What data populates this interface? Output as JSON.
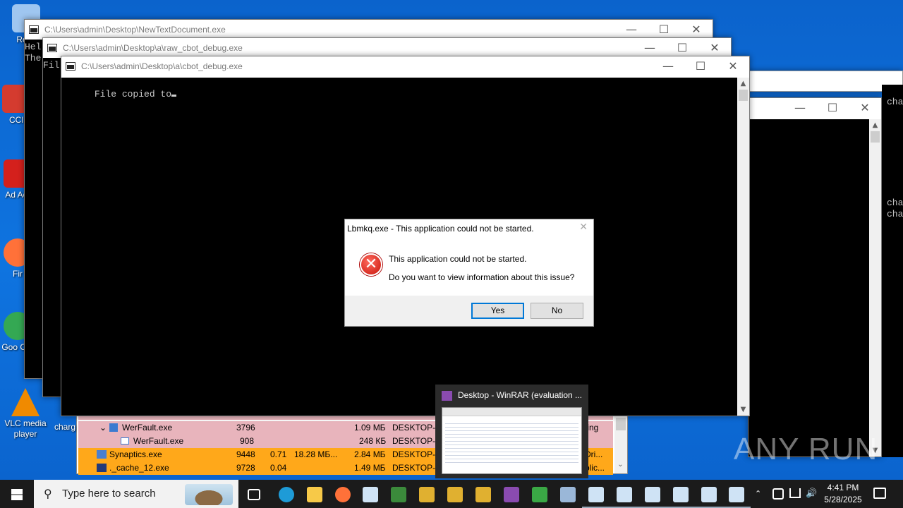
{
  "desktop_icons": [
    {
      "label": "Recy",
      "icon": "recycle-bin-icon",
      "color": "#9fc6f0"
    },
    {
      "label": "CCl",
      "icon": "ccleaner-icon",
      "color": "#d43b2f"
    },
    {
      "label": "Ad Acr",
      "icon": "acrobat-icon",
      "color": "#d4201c"
    },
    {
      "label": "Fir",
      "icon": "firefox-icon",
      "color": "#ff7139"
    },
    {
      "label": "Goo Chr",
      "icon": "chrome-icon",
      "color": "#34a853"
    },
    {
      "label": "VLC media player",
      "icon": "vlc-icon",
      "color": "#f08a00"
    }
  ],
  "windows": {
    "w1": {
      "title": "C:\\Users\\admin\\Desktop\\NewTextDocument.exe",
      "console": "Hel\nThe"
    },
    "w2": {
      "title": "C:\\Users\\admin\\Desktop\\a\\raw_cbot_debug.exe",
      "console": "Fil"
    },
    "w3": {
      "title": "C:\\Users\\admin\\Desktop\\a\\cbot_debug.exe",
      "console": "File copied to"
    },
    "right_console": {
      "l1": "cha",
      "l2": "cha",
      "l3": "cha"
    }
  },
  "procexp": {
    "rows": [
      {
        "name": "WerFault.exe",
        "pid": "3796",
        "cpu": "",
        "priv": "",
        "ws": "1.09 МБ",
        "user": "DESKTOP-JG",
        "desc": "ting",
        "bg": "#e8b4bc"
      },
      {
        "name": "WerFault.exe",
        "pid": "908",
        "cpu": "",
        "priv": "",
        "ws": "248 КБ",
        "user": "DESKTOP-JG",
        "desc": "",
        "bg": "#e8b4bc"
      },
      {
        "name": "Synaptics.exe",
        "pid": "9448",
        "cpu": "0.71",
        "priv": "18.28 МБ...",
        "ws": "2.84 МБ",
        "user": "DESKTOP-JG",
        "desc": "Dri...",
        "bg": "#ffa81a"
      },
      {
        "name": "._cache_12.exe",
        "pid": "9728",
        "cpu": "0.04",
        "priv": "",
        "ws": "1.49 МБ",
        "user": "DESKTOP-JG",
        "desc": "plic...",
        "bg": "#ffa81a"
      }
    ],
    "side_label": "charg"
  },
  "dialog": {
    "title": "Lbmkq.exe - This application could not be started.",
    "message": "This application could not be started.",
    "question": "Do you want to view information about this issue?",
    "yes": "Yes",
    "no": "No"
  },
  "thumbnail": {
    "title": "Desktop - WinRAR (evaluation ..."
  },
  "taskbar": {
    "search_placeholder": "Type here to search",
    "apps": [
      {
        "icon": "task-view-icon",
        "color": "#ffffff"
      },
      {
        "icon": "edge-icon",
        "color": "#1e9bd7"
      },
      {
        "icon": "file-explorer-icon",
        "color": "#f7c948"
      },
      {
        "icon": "firefox-icon",
        "color": "#ff7139"
      },
      {
        "icon": "console-window-icon",
        "color": "#cfe3f5"
      },
      {
        "icon": "chip-app-icon",
        "color": "#3b8a3b"
      },
      {
        "icon": "key-icon",
        "color": "#e0b030"
      },
      {
        "icon": "key-icon",
        "color": "#e0b030"
      },
      {
        "icon": "key-icon",
        "color": "#e0b030"
      },
      {
        "icon": "winrar-icon",
        "color": "#8a4bb0"
      },
      {
        "icon": "h-app-icon",
        "color": "#3aa845"
      },
      {
        "icon": "network-app-icon",
        "color": "#9ab7d8"
      },
      {
        "icon": "console-window-icon",
        "color": "#cfe3f5"
      },
      {
        "icon": "download-icon",
        "color": "#cfe3f5"
      },
      {
        "icon": "console-window-icon",
        "color": "#cfe3f5"
      },
      {
        "icon": "console-window-icon",
        "color": "#cfe3f5"
      },
      {
        "icon": "console-window-icon",
        "color": "#cfe3f5"
      },
      {
        "icon": "console-window-icon",
        "color": "#cfe3f5"
      }
    ],
    "time": "4:41 PM",
    "date": "5/28/2025"
  },
  "watermark": "ANY RUN"
}
